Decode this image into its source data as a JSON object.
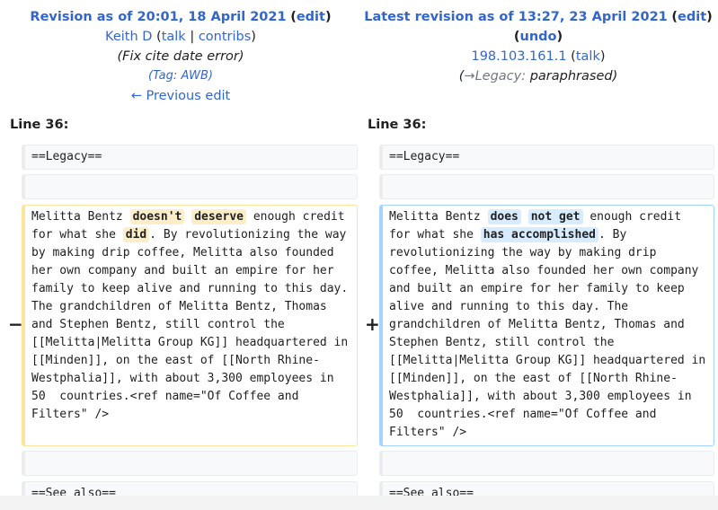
{
  "left_header": {
    "title": "Revision as of 20:01, 18 April 2021",
    "edit": "edit",
    "user": "Keith D",
    "talk": "talk",
    "contribs": "contribs",
    "summary": "(Fix cite date error)",
    "tag_prefix": "Tag:",
    "tag_name": "AWB",
    "prev_edit": "← Previous edit"
  },
  "right_header": {
    "title": "Latest revision as of 13:27, 23 April 2021",
    "edit": "edit",
    "undo": "undo",
    "user": "198.103.161.1",
    "talk": "talk",
    "summary_arrow": "→Legacy:",
    "summary_text": "paraphrased"
  },
  "line_label": "Line 36:",
  "markers": {
    "minus": "−",
    "plus": "+"
  },
  "diff": {
    "legacy_heading": "==Legacy==",
    "see_also_heading": "==See also==",
    "left_text": {
      "a": "Melitta Bentz ",
      "del1": "doesn't",
      "b": " ",
      "del2": "deserve",
      "c": " enough credit for what she ",
      "del3": "did",
      "d": ". By revolutionizing the way by making drip coffee, Melitta also founded her own company and built an empire for her family to keep alive and running to this day. The grandchildren of Melitta Bentz, Thomas and Stephen Bentz, still control the [[Melitta|Melitta Group KG]] headquartered in [[Minden]], on the east of [[North Rhine-Westphalia]], with about 3,300 employees in 50  countries.<ref name=\"Of Coffee and Filters\" />"
    },
    "right_text": {
      "a": "Melitta Bentz ",
      "add1": "does",
      "b": " ",
      "add2": "not get",
      "c": " enough credit for what she ",
      "add3": "has accomplished",
      "d": ". By revolutionizing the way by making drip coffee, Melitta also founded her own company and built an empire for her family to keep alive and running to this day. The grandchildren of Melitta Bentz, Thomas and Stephen Bentz, still control the [[Melitta|Melitta Group KG]] headquartered in [[Minden]], on the east of [[North Rhine-Westphalia]], with about 3,300 employees in 50  countries.<ref name=\"Of Coffee and Filters\" />"
    }
  }
}
